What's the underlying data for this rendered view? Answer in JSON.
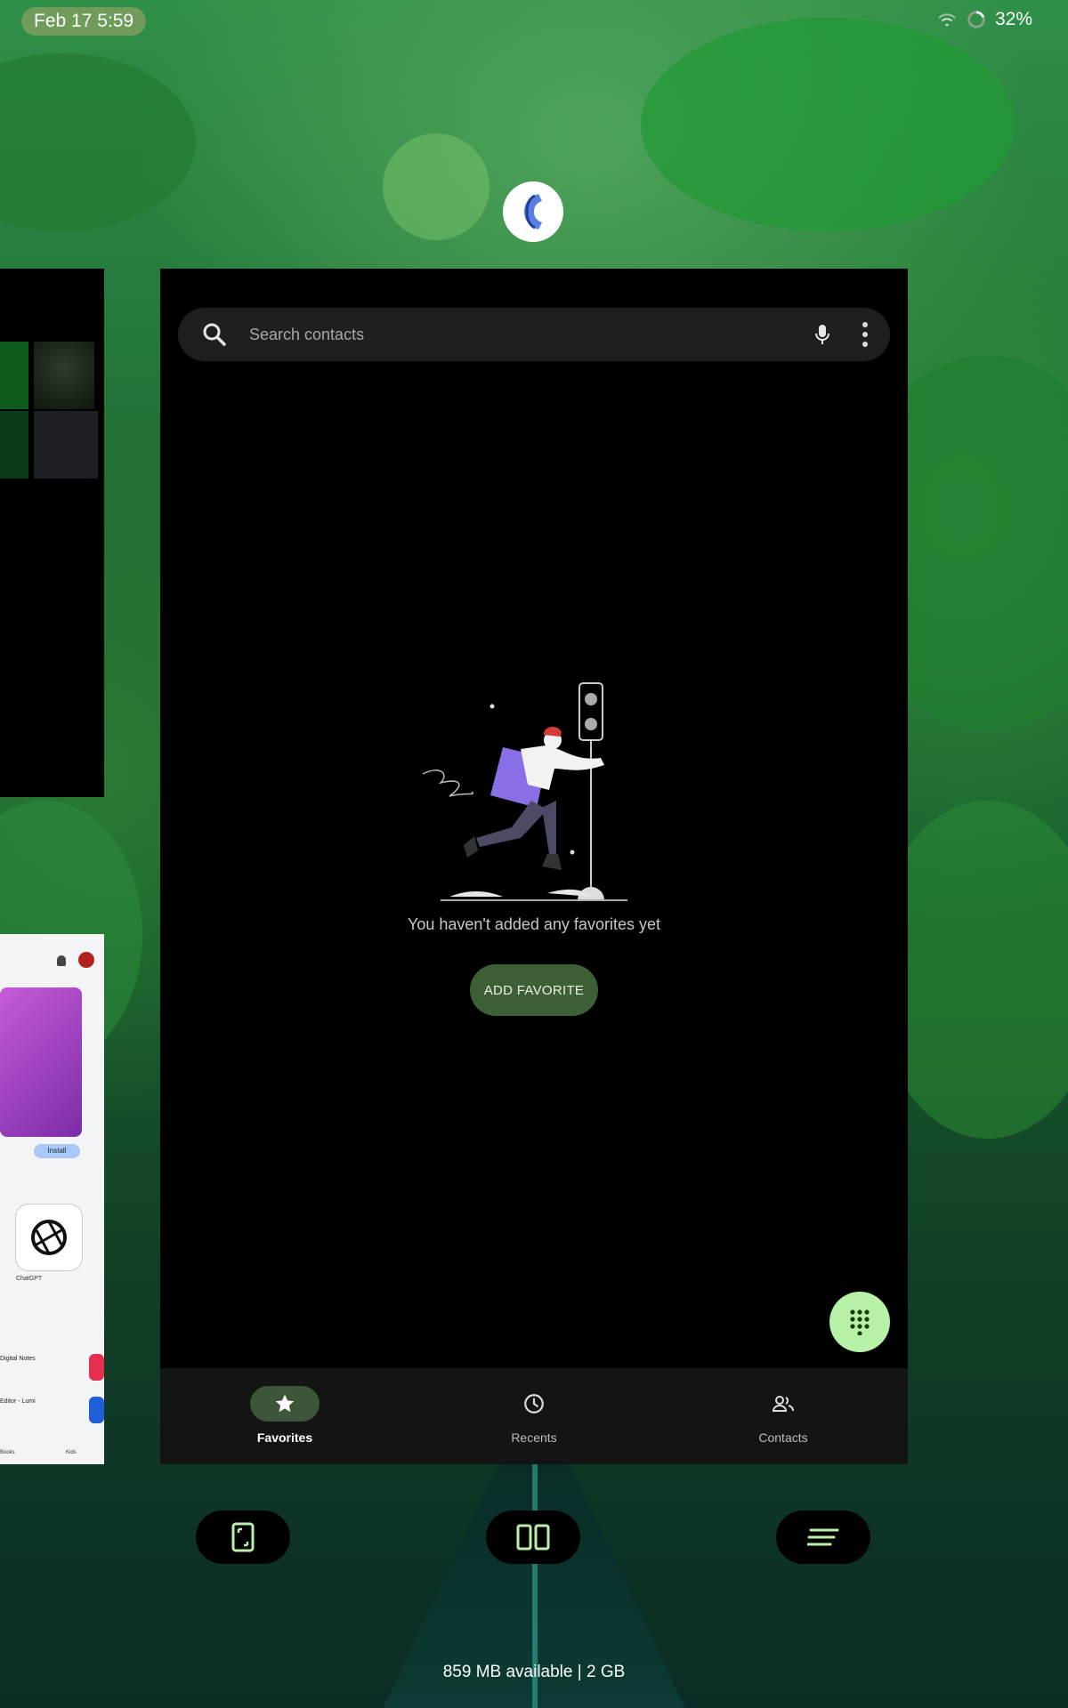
{
  "status_bar": {
    "datetime": "Feb 17 5:59",
    "battery": "32%"
  },
  "search": {
    "placeholder": "Search contacts"
  },
  "empty_state": {
    "message": "You haven't added any favorites yet",
    "button": "ADD FAVORITE"
  },
  "bottom_nav": {
    "items": [
      {
        "label": "Favorites",
        "icon": "star-icon",
        "active": true
      },
      {
        "label": "Recents",
        "icon": "clock-icon",
        "active": false
      },
      {
        "label": "Contacts",
        "icon": "people-icon",
        "active": false
      }
    ]
  },
  "left_preview": {
    "install_label": "Install",
    "app_label": "ChatGPT",
    "list_items": [
      "Digital Notes",
      "Editor - Lumi"
    ],
    "tabs": [
      "Books",
      "Kids"
    ]
  },
  "recents_actions": [
    "screenshot-icon",
    "split-screen-icon",
    "clear-all-icon"
  ],
  "memory": {
    "text": "859 MB available | 2 GB"
  },
  "colors": {
    "accent": "#b8f2a6",
    "nav_pill": "#3d5538",
    "add_button": "#3c5f36"
  }
}
